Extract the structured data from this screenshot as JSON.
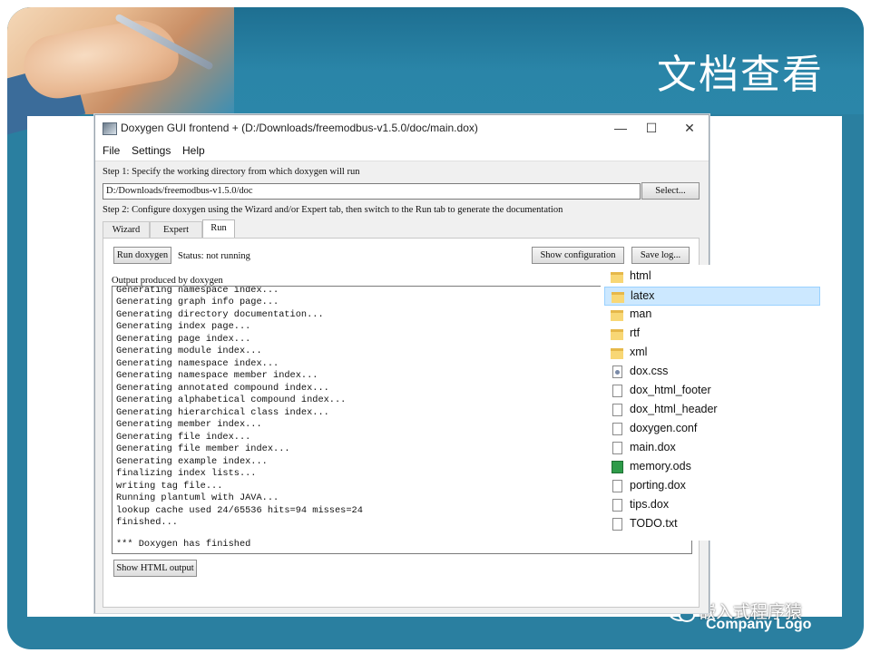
{
  "slide": {
    "title": "文档查看",
    "company_logo": "Company Logo",
    "watermark": "嵌入式程序猿"
  },
  "window": {
    "title": "Doxygen GUI frontend + (D:/Downloads/freemodbus-v1.5.0/doc/main.dox)",
    "controls": {
      "minimize": "—",
      "maximize": "☐",
      "close": "✕"
    },
    "menu": [
      "File",
      "Settings",
      "Help"
    ],
    "step1": "Step 1: Specify the working directory from which doxygen will run",
    "working_dir": "D:/Downloads/freemodbus-v1.5.0/doc",
    "select_button": "Select...",
    "step2": "Step 2: Configure doxygen using the Wizard and/or Expert tab, then switch to the Run tab to generate the documentation",
    "tabs": [
      "Wizard",
      "Expert",
      "Run"
    ],
    "active_tab": "Run",
    "run_button": "Run doxygen",
    "status": "Status: not running",
    "show_config_button": "Show configuration",
    "save_log_button": "Save log...",
    "output_label": "Output produced by doxygen",
    "log_lines": [
      "Generating namespace index...",
      "Generating graph info page...",
      "Generating directory documentation...",
      "Generating index page...",
      "Generating page index...",
      "Generating module index...",
      "Generating namespace index...",
      "Generating namespace member index...",
      "Generating annotated compound index...",
      "Generating alphabetical compound index...",
      "Generating hierarchical class index...",
      "Generating member index...",
      "Generating file index...",
      "Generating file member index...",
      "Generating example index...",
      "finalizing index lists...",
      "writing tag file...",
      "Running plantuml with JAVA...",
      "lookup cache used 24/65536 hits=94 misses=24",
      "finished...",
      "",
      "*** Doxygen has finished"
    ],
    "show_html_button": "Show HTML output"
  },
  "explorer": {
    "selected": "latex",
    "items": [
      {
        "name": "html",
        "icon": "folder-icon"
      },
      {
        "name": "latex",
        "icon": "folder-icon"
      },
      {
        "name": "man",
        "icon": "folder-icon"
      },
      {
        "name": "rtf",
        "icon": "folder-icon"
      },
      {
        "name": "xml",
        "icon": "folder-icon"
      },
      {
        "name": "dox.css",
        "icon": "css-file-icon"
      },
      {
        "name": "dox_html_footer",
        "icon": "file-icon"
      },
      {
        "name": "dox_html_header",
        "icon": "file-icon"
      },
      {
        "name": "doxygen.conf",
        "icon": "file-icon"
      },
      {
        "name": "main.dox",
        "icon": "file-icon"
      },
      {
        "name": "memory.ods",
        "icon": "spreadsheet-file-icon"
      },
      {
        "name": "porting.dox",
        "icon": "file-icon"
      },
      {
        "name": "tips.dox",
        "icon": "file-icon"
      },
      {
        "name": "TODO.txt",
        "icon": "file-icon"
      }
    ]
  }
}
